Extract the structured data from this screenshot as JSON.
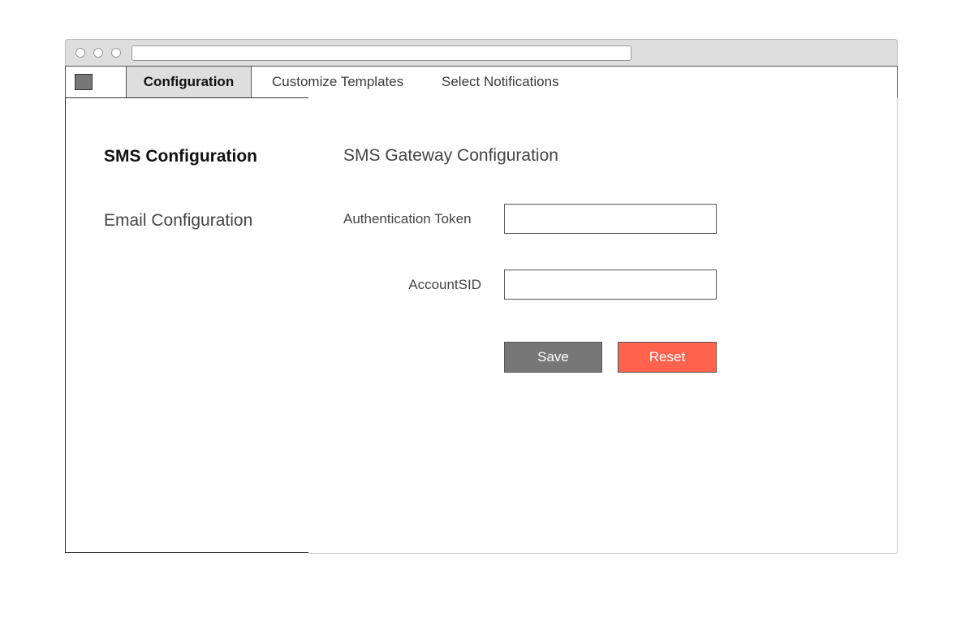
{
  "browser": {
    "url": ""
  },
  "nav": {
    "tabs": [
      {
        "label": "Configuration",
        "active": true
      },
      {
        "label": "Customize Templates",
        "active": false
      },
      {
        "label": "Select Notifications",
        "active": false
      }
    ]
  },
  "sidebar": {
    "items": [
      {
        "label": "SMS Configuration",
        "active": true
      },
      {
        "label": "Email Configuration",
        "active": false
      }
    ]
  },
  "main": {
    "title": "SMS Gateway Configuration",
    "fields": [
      {
        "label": "Authentication Token",
        "value": ""
      },
      {
        "label": "AccountSID",
        "value": ""
      }
    ],
    "save_label": "Save",
    "reset_label": "Reset"
  },
  "colors": {
    "save": "#777777",
    "reset": "#ff624d",
    "active_tab": "#dedede"
  }
}
